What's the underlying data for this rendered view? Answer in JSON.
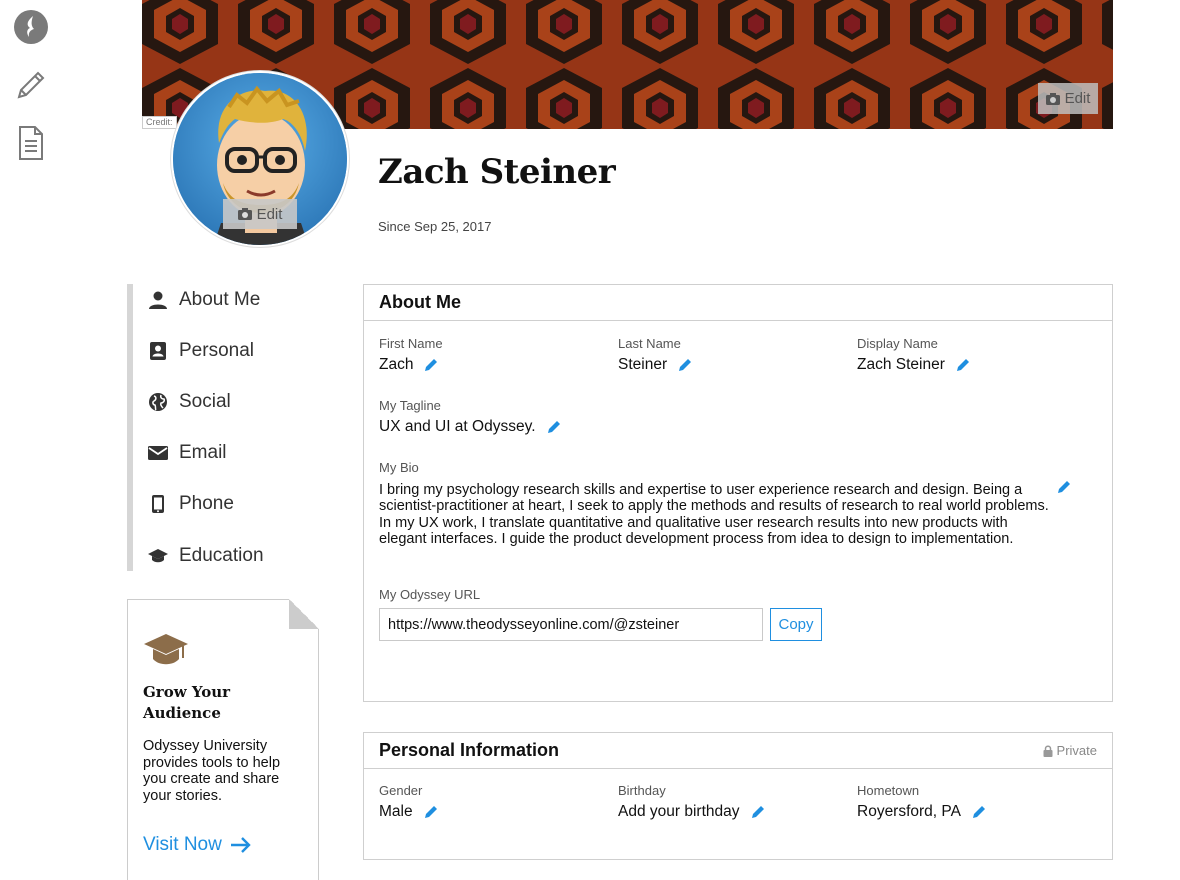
{
  "rail": {
    "icons": [
      "odyssey-logo-icon",
      "pencil-icon",
      "document-icon"
    ]
  },
  "cover": {
    "credit_label": "Credit:",
    "edit_label": "Edit"
  },
  "avatar": {
    "edit_label": "Edit"
  },
  "profile": {
    "name": "Zach Steiner",
    "since": "Since Sep 25, 2017"
  },
  "sidenav": {
    "items": [
      {
        "label": "About Me",
        "icon": "person-icon"
      },
      {
        "label": "Personal",
        "icon": "contact-card-icon"
      },
      {
        "label": "Social",
        "icon": "globe-icon"
      },
      {
        "label": "Email",
        "icon": "envelope-icon"
      },
      {
        "label": "Phone",
        "icon": "phone-icon"
      },
      {
        "label": "Education",
        "icon": "graduation-cap-icon"
      }
    ]
  },
  "promo": {
    "title": "Grow Your Audience",
    "text": "Odyssey University provides tools to help you create and share your stories.",
    "link_label": "Visit Now"
  },
  "about": {
    "title": "About Me",
    "first_name": {
      "label": "First Name",
      "value": "Zach"
    },
    "last_name": {
      "label": "Last Name",
      "value": "Steiner"
    },
    "display_name": {
      "label": "Display Name",
      "value": "Zach Steiner"
    },
    "tagline": {
      "label": "My Tagline",
      "value": "UX and UI at Odyssey."
    },
    "bio": {
      "label": "My Bio",
      "value": "I bring my psychology research skills and expertise to user experience research and design. Being a scientist-practitioner at heart, I seek to apply the methods and results of research to real world problems. In my UX work, I translate quantitative and qualitative user research results into new products with elegant interfaces. I guide the product development process from idea to design to implementation."
    },
    "url": {
      "label": "My Odyssey URL",
      "value": "https://www.theodysseyonline.com/@zsteiner",
      "copy_label": "Copy"
    }
  },
  "personal": {
    "title": "Personal Information",
    "privacy_label": "Private",
    "gender": {
      "label": "Gender",
      "value": "Male"
    },
    "birthday": {
      "label": "Birthday",
      "value": "Add your birthday"
    },
    "hometown": {
      "label": "Hometown",
      "value": "Royersford, PA"
    }
  },
  "colors": {
    "accent": "#1f8fe0",
    "nav_rule": "#d6d6d6",
    "border": "#cfcfcf",
    "promo_icon": "#8c6d4a"
  }
}
